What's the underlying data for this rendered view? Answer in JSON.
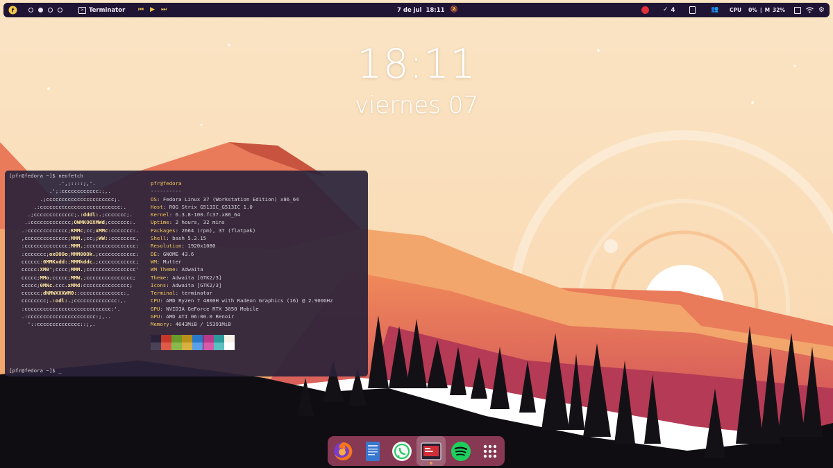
{
  "topbar": {
    "active_window": "Terminator",
    "clock": "7 de jul  18:11",
    "notifications_count": "4",
    "cpu_label": "CPU",
    "cpu_value": "0%",
    "mem_label": "M",
    "mem_value": "32%",
    "workspaces": [
      false,
      true,
      false,
      false
    ],
    "icons": [
      "fedora-logo-icon",
      "terminal-icon",
      "previous-track-icon",
      "play-icon",
      "next-track-icon",
      "do-not-disturb-icon",
      "record-icon",
      "check-icon",
      "clipboard-icon",
      "people-icon",
      "screenshot-icon",
      "wifi-icon",
      "settings-icon"
    ]
  },
  "lockscreen": {
    "time": "18:11",
    "date": "viernes 07"
  },
  "terminal": {
    "prompt_command": "[pfr@fedora ~]$ neofetch",
    "prompt_idle": "[pfr@fedora ~]$ _",
    "logo": [
      [
        [
          "                .',;::::;,'.",
          "a"
        ]
      ],
      [
        [
          "             .';:cccccccccccc:;,.",
          "a"
        ]
      ],
      [
        [
          "          .;cccccccccccccccccccccc;.",
          "a"
        ]
      ],
      [
        [
          "        .:cccccccccccccccccccccccccc:.",
          "a"
        ]
      ],
      [
        [
          "      .;ccccccccccccc;",
          "a"
        ],
        [
          ".:dddl:.",
          "b"
        ],
        [
          ";ccccccc;.",
          "a"
        ]
      ],
      [
        [
          "     .:ccccccccccccc;",
          "a"
        ],
        [
          "OWMKOOXMWd",
          "b"
        ],
        [
          ";ccccccc:.",
          "a"
        ]
      ],
      [
        [
          "    .:ccccccccccccc;",
          "a"
        ],
        [
          "KMMc",
          "b"
        ],
        [
          ";cc;",
          "a"
        ],
        [
          "xMMc",
          "b"
        ],
        [
          ":ccccccc:.",
          "a"
        ]
      ],
      [
        [
          "    ,cccccccccccccc;",
          "a"
        ],
        [
          "MMM.",
          "b"
        ],
        [
          ";cc;",
          "a"
        ],
        [
          ";WW:",
          "b"
        ],
        [
          ":cccccccc,",
          "a"
        ]
      ],
      [
        [
          "    :cccccccccccccc;",
          "a"
        ],
        [
          "MMM.",
          "b"
        ],
        [
          ";cccccccccccccccc:",
          "a"
        ]
      ],
      [
        [
          "    :ccccccc;",
          "a"
        ],
        [
          "oxOOOo",
          "b"
        ],
        [
          ";",
          "a"
        ],
        [
          "MMM0OOk.",
          "b"
        ],
        [
          ";cccccccccccc:",
          "a"
        ]
      ],
      [
        [
          "    cccccc:",
          "a"
        ],
        [
          "0MMKxdd:",
          "b"
        ],
        [
          ";",
          "a"
        ],
        [
          "MMMkddc.",
          "b"
        ],
        [
          ";cccccccccccc;",
          "a"
        ]
      ],
      [
        [
          "    ccccc:",
          "a"
        ],
        [
          "XM0'",
          "b"
        ],
        [
          ";cccc;",
          "a"
        ],
        [
          "MMM.",
          "b"
        ],
        [
          ";cccccccccccccccc'",
          "a"
        ]
      ],
      [
        [
          "    ccccc;",
          "a"
        ],
        [
          "MMo",
          "b"
        ],
        [
          ";ccccc;",
          "a"
        ],
        [
          "MMW.",
          "b"
        ],
        [
          ";ccccccccccccccc;",
          "a"
        ]
      ],
      [
        [
          "    ccccc;",
          "a"
        ],
        [
          "0MNc.",
          "b"
        ],
        [
          "ccc",
          "a"
        ],
        [
          ".xMMd",
          "b"
        ],
        [
          ":ccccccccccccccc;",
          "a"
        ]
      ],
      [
        [
          "    cccccc;",
          "a"
        ],
        [
          "dNMWXXXWM0:",
          "b"
        ],
        [
          ":cccccccccccccc:,",
          "a"
        ]
      ],
      [
        [
          "    cccccccc;",
          "a"
        ],
        [
          ".:odl:.",
          "b"
        ],
        [
          ";cccccccccccccc:,.",
          "a"
        ]
      ],
      [
        [
          "    :cccccccccccccccccccccccccccc:'.",
          "a"
        ]
      ],
      [
        [
          "    .:cccccccccccccccccccccc:;,..",
          "a"
        ]
      ],
      [
        [
          "      '::cccccccccccccc::;,.",
          "a"
        ]
      ]
    ],
    "info_header": "pfr@fedora",
    "info_separator": "----------",
    "info": [
      {
        "key": "OS",
        "value": "Fedora Linux 37 (Workstation Edition) x86_64"
      },
      {
        "key": "Host",
        "value": "ROG Strix G513IC_G513IC 1.0"
      },
      {
        "key": "Kernel",
        "value": "6.3.8-100.fc37.x86_64"
      },
      {
        "key": "Uptime",
        "value": "2 hours, 32 mins"
      },
      {
        "key": "Packages",
        "value": "2664 (rpm), 37 (flatpak)"
      },
      {
        "key": "Shell",
        "value": "bash 5.2.15"
      },
      {
        "key": "Resolution",
        "value": "1920x1080"
      },
      {
        "key": "DE",
        "value": "GNOME 43.6"
      },
      {
        "key": "WM",
        "value": "Mutter"
      },
      {
        "key": "WM Theme",
        "value": "Adwaita"
      },
      {
        "key": "Theme",
        "value": "Adwaita [GTK2/3]"
      },
      {
        "key": "Icons",
        "value": "Adwaita [GTK2/3]"
      },
      {
        "key": "Terminal",
        "value": "terminator"
      },
      {
        "key": "CPU",
        "value": "AMD Ryzen 7 4800H with Radeon Graphics (16) @ 2.900GHz"
      },
      {
        "key": "GPU",
        "value": "NVIDIA GeForce RTX 3050 Mobile"
      },
      {
        "key": "GPU",
        "value": "AMD ATI 06:00.0 Renoir"
      },
      {
        "key": "Memory",
        "value": "4643MiB / 15391MiB"
      }
    ],
    "palette_top": [
      "#2a223a",
      "#c6362a",
      "#6a9a2a",
      "#b8901a",
      "#2a78c8",
      "#b8388a",
      "#2a9a9a",
      "#f8f2e8"
    ],
    "palette_bottom": [
      "#4a4258",
      "#e05a48",
      "#8ab84a",
      "#d8b040",
      "#5aa0e8",
      "#d85aaa",
      "#5ac0c0",
      "#ffffff"
    ]
  },
  "dock": {
    "apps": [
      {
        "name": "firefox-icon"
      },
      {
        "name": "text-editor-icon"
      },
      {
        "name": "whatsapp-icon"
      },
      {
        "name": "terminator-icon",
        "running": true
      },
      {
        "name": "spotify-icon"
      },
      {
        "name": "app-grid-icon"
      }
    ]
  }
}
